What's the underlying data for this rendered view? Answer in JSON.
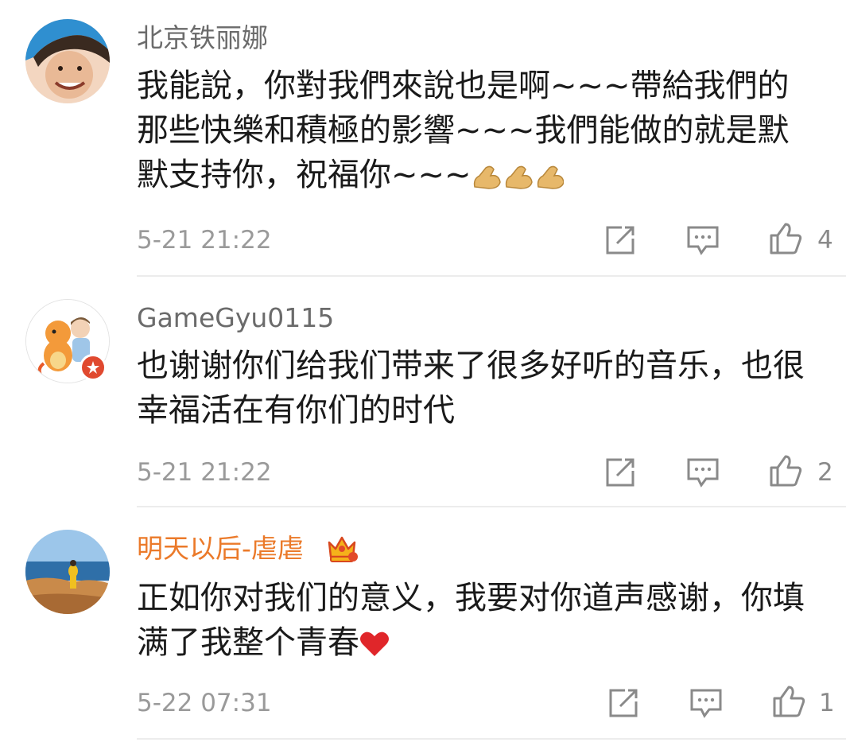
{
  "comments": [
    {
      "username": "北京铁丽娜",
      "text": "我能說，你對我們來說也是啊~~~帶給我們的那些快樂和積極的影響~~~我們能做的就是默默支持你，祝福你~~~",
      "emoji": "flexed-biceps x3",
      "time": "5-21 21:22",
      "likes": "4"
    },
    {
      "username": "GameGyu0115",
      "text": "也谢谢你们给我们带来了很多好听的音乐，也很幸福活在有你们的时代",
      "time": "5-21 21:22",
      "likes": "2"
    },
    {
      "username": "明天以后-虐虐",
      "text": "正如你对我们的意义，我要对你道声感谢，你填满了我整个青春",
      "emoji": "red-heart",
      "time": "5-22 07:31",
      "likes": "1"
    }
  ],
  "colors": {
    "username": "#6b6b6b",
    "vip_username": "#eb7a2a",
    "text": "#1a1a1a",
    "meta": "#9a9a9a",
    "divider": "#ececec",
    "badge": "#e0492f"
  },
  "icons": [
    "repost-icon",
    "comment-icon",
    "like-icon",
    "vip-crown-icon",
    "verified-badge-icon"
  ]
}
